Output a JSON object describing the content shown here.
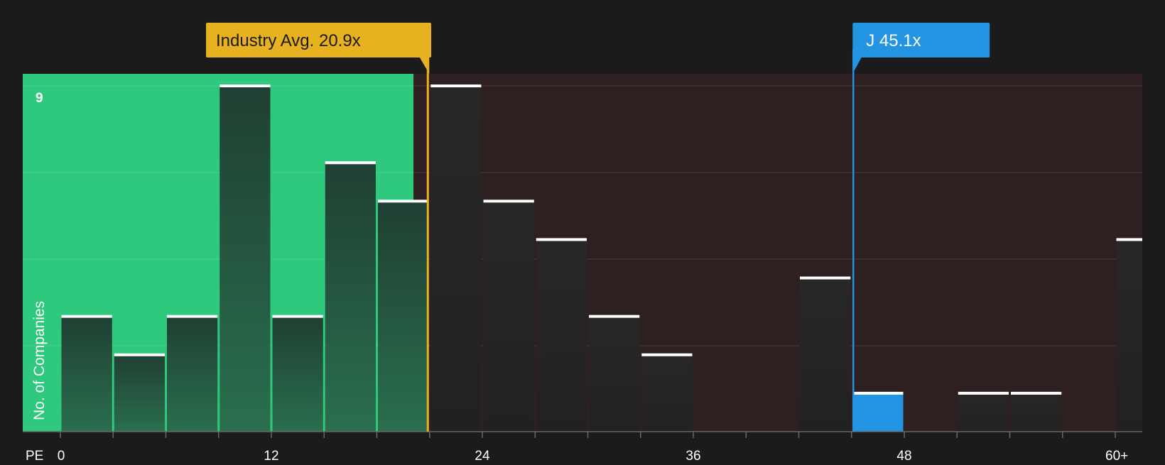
{
  "chart_data": {
    "type": "bar",
    "xlabel": "PE",
    "ylabel": "No. of Companies",
    "x_tick_labels": [
      "0",
      "12",
      "24",
      "36",
      "48",
      "60+"
    ],
    "x_ticks": [
      0,
      12,
      24,
      36,
      48,
      60
    ],
    "xlim": [
      0,
      61.5
    ],
    "y_tick_labels": [
      "9"
    ],
    "ylim": [
      0,
      9.3
    ],
    "grid": true,
    "bin_width": 3,
    "bins": [
      {
        "x0": 0,
        "value": 3
      },
      {
        "x0": 3,
        "value": 2
      },
      {
        "x0": 6,
        "value": 3
      },
      {
        "x0": 9,
        "value": 9
      },
      {
        "x0": 12,
        "value": 3
      },
      {
        "x0": 15,
        "value": 7
      },
      {
        "x0": 18,
        "value": 6
      },
      {
        "x0": 21,
        "value": 9
      },
      {
        "x0": 24,
        "value": 6
      },
      {
        "x0": 27,
        "value": 5
      },
      {
        "x0": 30,
        "value": 3
      },
      {
        "x0": 33,
        "value": 2
      },
      {
        "x0": 36,
        "value": 0
      },
      {
        "x0": 39,
        "value": 0
      },
      {
        "x0": 42,
        "value": 4
      },
      {
        "x0": 45,
        "value": 1,
        "highlight": true
      },
      {
        "x0": 48,
        "value": 0
      },
      {
        "x0": 51,
        "value": 1
      },
      {
        "x0": 54,
        "value": 1
      },
      {
        "x0": 57,
        "value": 0
      },
      {
        "x0": 60,
        "value": 5
      }
    ],
    "industry_avg": {
      "label": "Industry Avg. 20.9x",
      "value": 20.9
    },
    "company": {
      "label": "J 45.1x",
      "value": 45.1
    },
    "colors": {
      "background": "#1b1b1b",
      "below_region": "#2ec97d",
      "above_region": "#2e1f20",
      "bar_green": "#23483a",
      "bar_dark": "#252424",
      "bar_highlight": "#2394e2",
      "bar_cap": "#ffffff",
      "industry_marker": "#e8b120",
      "company_marker": "#2394e2",
      "axis_text": "#ffffff"
    }
  }
}
